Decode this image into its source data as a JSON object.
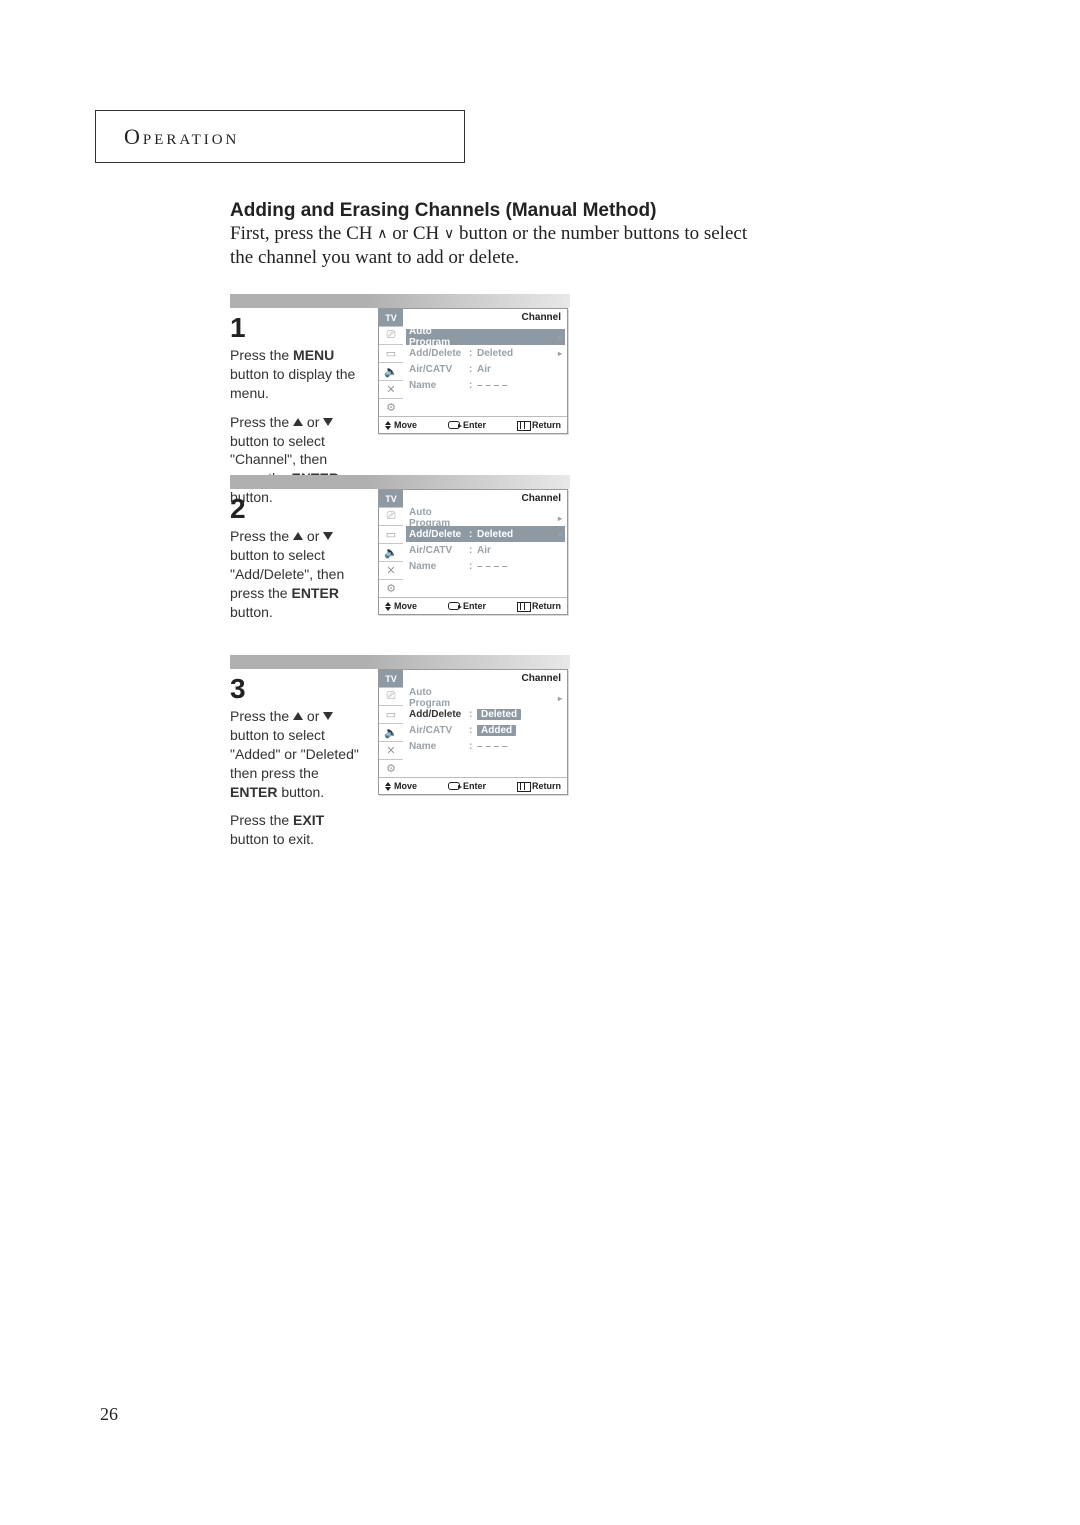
{
  "page_number": "26",
  "operation_label": "Operation",
  "heading": "Adding and Erasing Channels (Manual Method)",
  "intro": {
    "part1": "First, press the CH ",
    "part2": " or CH ",
    "part3": " button or the number buttons to select the channel you want to add or delete."
  },
  "steps": [
    {
      "num": "1",
      "para1_a": "Press the ",
      "para1_b": "MENU",
      "para1_c": " button to display the menu.",
      "para2_a": "Press the ",
      "para2_b": " or ",
      "para2_c": " button to select \"Channel\", then press the ",
      "para2_d": "ENTER",
      "para2_e": " button."
    },
    {
      "num": "2",
      "para1_a": "Press the ",
      "para1_b": " or ",
      "para1_c": " button to select \"Add/Delete\", then press the ",
      "para1_d": "ENTER",
      "para1_e": " button."
    },
    {
      "num": "3",
      "para1_a": "Press the ",
      "para1_b": " or ",
      "para1_c": " button to select \"Added\" or \"Deleted\" then press the ",
      "para1_d": "ENTER",
      "para1_e": " button.",
      "para2_a": "Press the ",
      "para2_b": "EXIT",
      "para2_c": " button to exit."
    }
  ],
  "tv": {
    "sidebar_head": "TV",
    "title": "Channel",
    "rows": {
      "auto": "Auto Program",
      "add": "Add/Delete",
      "add_val": "Deleted",
      "air": "Air/CATV",
      "air_val": "Air",
      "name": "Name",
      "name_val": "– – – –"
    },
    "popup_deleted": "Deleted",
    "popup_added": "Added",
    "footer": {
      "move": "Move",
      "enter": "Enter",
      "return": "Return"
    }
  }
}
